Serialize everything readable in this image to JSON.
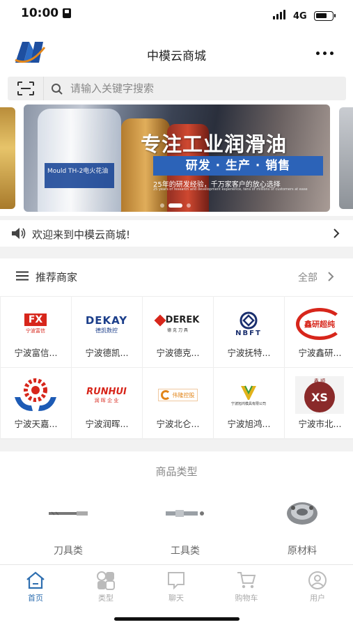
{
  "status_bar": {
    "time": "10:00",
    "network": "4G"
  },
  "header": {
    "title": "中模云商城"
  },
  "search": {
    "placeholder": "请输入关键字搜索"
  },
  "banner": {
    "headline": "专注工业润滑油",
    "subtitle": "研发 · 生产 · 销售",
    "tagline": "25年的研发经验，千万家客户的放心选择",
    "tagline_en": "25 years of research and development experience, tens of millions of customers at ease",
    "bottle_label": "Mould TH-2电火花油"
  },
  "notice": {
    "text": "欢迎来到中模云商城!"
  },
  "merchants": {
    "title": "推荐商家",
    "all_label": "全部",
    "items": [
      {
        "name": "宁波富信...",
        "logo_text": "FX",
        "logo_sub": "宁波富信"
      },
      {
        "name": "宁波德凯...",
        "logo_text": "DEKAY",
        "logo_sub": "德凯数控"
      },
      {
        "name": "宁波德克...",
        "logo_text": "DEREK",
        "logo_sub": "德 克 刀 具"
      },
      {
        "name": "宁波抚特...",
        "logo_text": "NBFT"
      },
      {
        "name": "宁波鑫研...",
        "logo_text": "鑫研超纯"
      },
      {
        "name": "宁波天嘉...",
        "logo_text": ""
      },
      {
        "name": "宁波润晖...",
        "logo_text": "RUNHUI",
        "logo_sub": "润 晖 企 业"
      },
      {
        "name": "宁波北仑...",
        "logo_text": "伟隆控股"
      },
      {
        "name": "宁波旭鸿...",
        "logo_text": "宁波旭鸿模具有限公司"
      },
      {
        "name": "宁波市北...",
        "logo_text": "XS",
        "logo_sub": "鑫 顺"
      }
    ]
  },
  "categories": {
    "title": "商品类型",
    "items": [
      {
        "label": "刀具类"
      },
      {
        "label": "工具类"
      },
      {
        "label": "原材料"
      }
    ]
  },
  "tabbar": {
    "items": [
      {
        "label": "首页",
        "active": true
      },
      {
        "label": "类型",
        "active": false
      },
      {
        "label": "聊天",
        "active": false
      },
      {
        "label": "购物车",
        "active": false
      },
      {
        "label": "用户",
        "active": false
      }
    ]
  },
  "colors": {
    "accent": "#2f6fb0",
    "tab_inactive": "#aaaaaa",
    "brand_red": "#d7261b"
  }
}
